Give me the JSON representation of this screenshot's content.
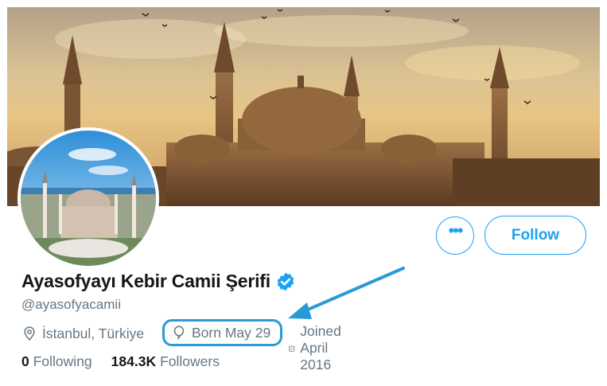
{
  "profile": {
    "display_name": "Ayasofyayı Kebir Camii Şerifi",
    "handle": "@ayasofyacamii",
    "location": "İstanbul, Türkiye",
    "birthday": "Born May 29",
    "joined": "Joined April 2016"
  },
  "buttons": {
    "more_label": "•••",
    "follow_label": "Follow"
  },
  "stats": {
    "following_count": "0",
    "following_label": "Following",
    "followers_count": "184.3K",
    "followers_label": "Followers"
  },
  "colors": {
    "accent": "#1da1f2",
    "annotation": "#2a9ad6",
    "text_primary": "#14171a",
    "text_secondary": "#657786"
  }
}
